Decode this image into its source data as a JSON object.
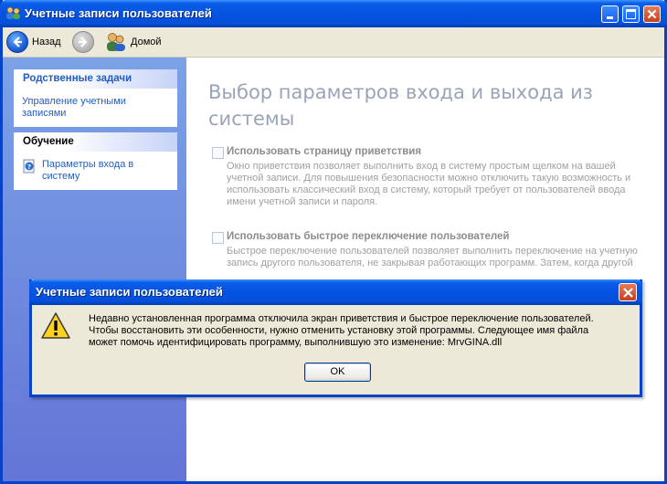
{
  "window": {
    "title": "Учетные записи пользователей"
  },
  "toolbar": {
    "back_label": "Назад",
    "home_label": "Домой"
  },
  "sidebar": {
    "groups": [
      {
        "header": "Родственные задачи",
        "items": [
          {
            "label": "Управление учетными записями"
          }
        ]
      },
      {
        "header": "Обучение",
        "items": [
          {
            "label": "Параметры входа в систему"
          }
        ]
      }
    ]
  },
  "main": {
    "heading": "Выбор параметров входа и выхода из системы",
    "options": [
      {
        "label": "Использовать страницу приветствия",
        "description": "Окно приветствия позволяет выполнить вход в систему простым щелком на вашей учетной записи. Для повышения безопасности можно отключить такую возможность и использовать классический вход в систему, который требует от пользователей ввода имени учетной записи и пароля.",
        "checked": false
      },
      {
        "label": "Использовать быстрое переключение пользователей",
        "description": "Быстрое переключение пользователей позволяет выполнить переключение на учетную запись другого пользователя, не закрывая работающих программ. Затем, когда другой",
        "checked": false
      }
    ]
  },
  "dialog": {
    "title": "Учетные записи пользователей",
    "message": "Недавно установленная программа отключила экран приветствия и быстрое переключение пользователей. Чтобы восстановить эти особенности, нужно отменить установку этой программы. Следующее имя файла может помочь идентифицировать программу, выполнившую это изменение:  MrvGINA.dll",
    "ok_label": "OK"
  },
  "colors": {
    "title_blue": "#0553e2",
    "sidebar_blue": "#6375d6",
    "link_blue": "#215dc6",
    "close_red": "#c8401c",
    "disabled_gray": "#a0a0a0"
  },
  "icons": {
    "title": "users-icon",
    "back": "back-arrow-icon",
    "forward": "forward-arrow-icon",
    "home": "users-home-icon",
    "help": "help-icon",
    "warning": "warning-icon"
  }
}
